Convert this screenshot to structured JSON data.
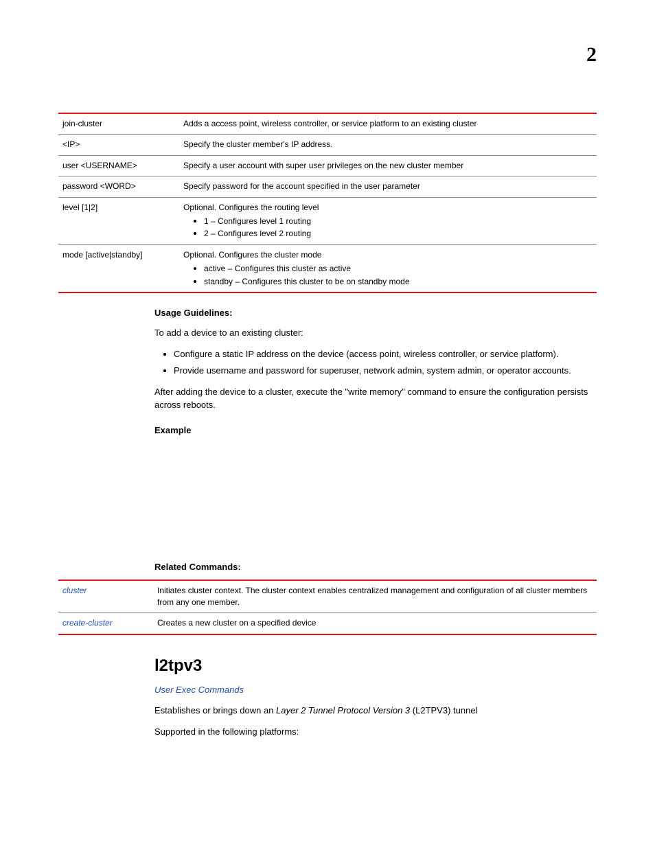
{
  "chapter_number": "2",
  "param_table": [
    {
      "key": "join-cluster",
      "desc": "Adds a access point, wireless controller, or service platform to an existing cluster"
    },
    {
      "key": "<IP>",
      "desc": "Specify the cluster member's IP address."
    },
    {
      "key": "user <USERNAME>",
      "desc": "Specify a user account with super user privileges on the new cluster member"
    },
    {
      "key": "password <WORD>",
      "desc": "Specify password for the account specified in the user parameter"
    },
    {
      "key": "level [1|2]",
      "desc": "Optional. Configures the routing level",
      "bullets": [
        "1 – Configures level 1 routing",
        "2 – Configures level 2 routing"
      ]
    },
    {
      "key": "mode [active|standby]",
      "desc": "Optional. Configures the cluster mode",
      "bullets": [
        "active – Configures this cluster as active",
        "standby – Configures this cluster to be on standby mode"
      ]
    }
  ],
  "usage": {
    "heading": "Usage Guidelines:",
    "intro": "To add a device to an existing cluster:",
    "bullets": [
      "Configure a static IP address on the device (access point, wireless controller, or service platform).",
      "Provide username and password for superuser, network admin, system admin, or operator accounts."
    ],
    "outro": "After adding the device to a cluster, execute the \"write memory\" command to ensure the configuration persists across reboots."
  },
  "example_heading": "Example",
  "related": {
    "heading": "Related Commands:",
    "rows": [
      {
        "cmd": "cluster",
        "desc": "Initiates cluster context. The cluster context enables centralized management and configuration of all cluster members from any one member."
      },
      {
        "cmd": "create-cluster",
        "desc": "Creates a new cluster on a specified device"
      }
    ]
  },
  "section": {
    "title": "l2tpv3",
    "breadcrumb": "User Exec Commands",
    "line1_pre": "Establishes or brings down an ",
    "line1_italic": "Layer 2 Tunnel Protocol Version 3",
    "line1_post": " (L2TPV3) tunnel",
    "line2": "Supported in the following platforms:"
  }
}
